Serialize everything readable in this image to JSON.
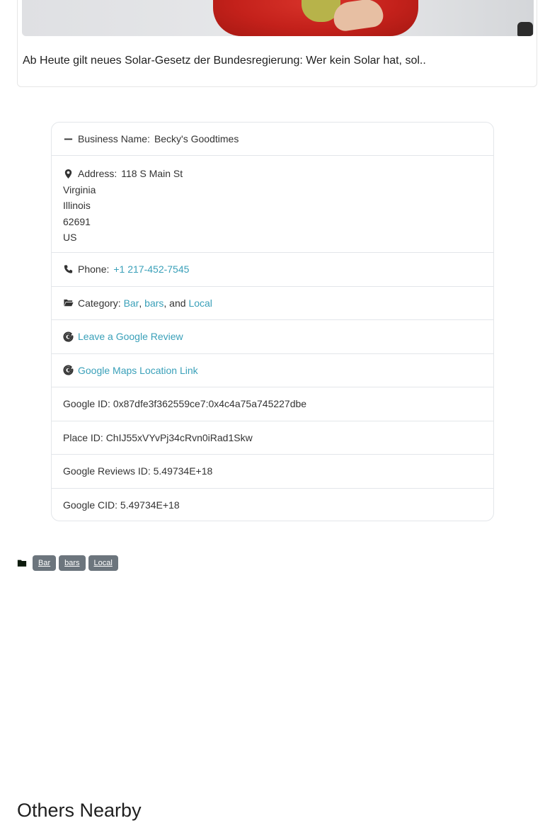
{
  "ad": {
    "caption": "Ab Heute gilt neues Solar-Gesetz der Bundesregierung: Wer kein Solar hat, sol.."
  },
  "business": {
    "name_label": "Business Name:",
    "name_value": "Becky's Goodtimes",
    "address_label": "Address:",
    "address_street": "118 S Main St",
    "address_city": "Virginia",
    "address_state": "Illinois",
    "address_zip": "62691",
    "address_country": "US",
    "phone_label": "Phone:",
    "phone_value": "+1 217-452-7545",
    "category_label": "Category:",
    "categories": [
      "Bar",
      "bars",
      "Local"
    ],
    "category_sep1": ",",
    "category_sep2": ", and",
    "review_link": "Leave a Google Review",
    "maps_link": "Google Maps Location Link",
    "google_id": "Google ID: 0x87dfe3f362559ce7:0x4c4a75a745227dbe",
    "place_id": "Place ID: ChIJ55xVYvPj34cRvn0iRad1Skw",
    "reviews_id": "Google Reviews ID: 5.49734E+18",
    "cid": "Google CID: 5.49734E+18"
  },
  "tags": [
    "Bar",
    "bars",
    "Local"
  ],
  "section": {
    "heading": "Others Nearby"
  },
  "colors": {
    "link": "#3aa0b9",
    "tag_bg": "#6c757d"
  }
}
